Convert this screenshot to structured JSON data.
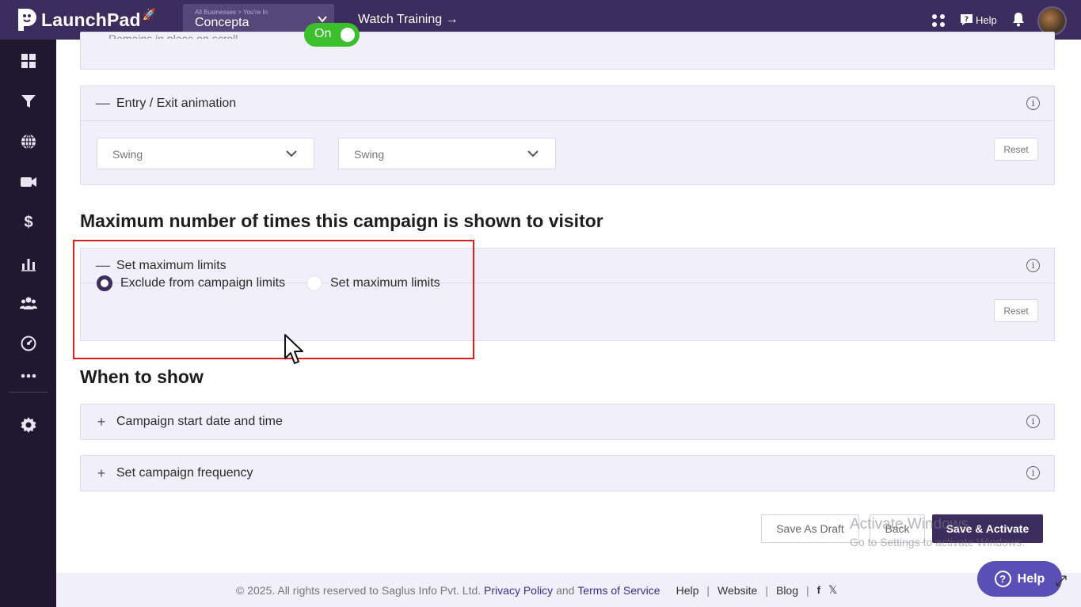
{
  "topbar": {
    "brand": "LaunchPad",
    "business_caption": "All Businesses > You're In",
    "business_name": "Concepta",
    "watch_training": "Watch Training →",
    "help_label": "Help"
  },
  "sidebar": {
    "items": [
      "dashboard-icon",
      "funnel-icon",
      "globe-icon",
      "video-icon",
      "dollar-icon",
      "chart-icon",
      "users-icon",
      "gauge-icon",
      "more-icon",
      "settings-icon"
    ]
  },
  "top_panel": {
    "partial_text": "Remains in place on scroll",
    "toggle_label": "On"
  },
  "animation": {
    "title": "Entry / Exit animation",
    "entry_value": "Swing",
    "exit_value": "Swing",
    "reset": "Reset"
  },
  "max_section": {
    "heading": "Maximum number of times this campaign is shown to visitor",
    "panel_title": "Set maximum limits",
    "option_exclude": "Exclude from campaign limits",
    "option_set": "Set maximum limits",
    "selected": "Exclude from campaign limits",
    "reset": "Reset"
  },
  "when_section": {
    "heading": "When to show",
    "start_title": "Campaign start date and time",
    "frequency_title": "Set campaign frequency"
  },
  "actions": {
    "save_draft": "Save As Draft",
    "back": "Back",
    "save_activate": "Save & Activate"
  },
  "watermark": {
    "line1": "Activate Windows",
    "line2": "Go to Settings to activate Windows."
  },
  "footer": {
    "copyright": "©  2025. All rights reserved to Saglus Info Pvt. Ltd.",
    "privacy": "Privacy Policy",
    "and": "and",
    "terms": "Terms of Service",
    "help": "Help",
    "website": "Website",
    "blog": "Blog"
  },
  "help_button": "Help",
  "colors": {
    "topbar": "#3d2c5e",
    "sidebar": "#1f1830",
    "panel": "#f1f0fa",
    "accent_green": "#3bbf2d",
    "highlight_red": "#e31b1b",
    "help_button": "#5a4fb7"
  }
}
